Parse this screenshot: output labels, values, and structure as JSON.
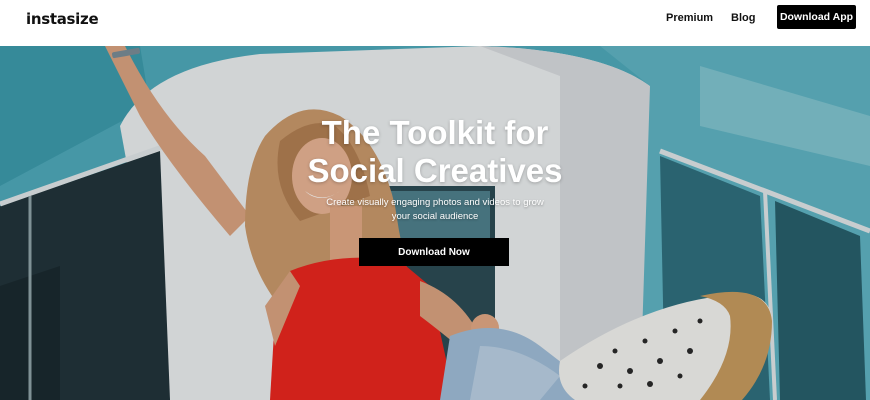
{
  "header": {
    "logo": "instasize",
    "nav": {
      "premium": "Premium",
      "blog": "Blog",
      "download_app": "Download App"
    }
  },
  "hero": {
    "title_line1": "The Toolkit for",
    "title_line2": "Social Creatives",
    "subtitle_line1": "Create visually engaging photos and videos to grow",
    "subtitle_line2": "your social audience",
    "cta_label": "Download Now"
  },
  "colors": {
    "header_bg": "#ffffff",
    "cta_bg": "#000000",
    "cta_text": "#ffffff",
    "wall_teal": "#4aa7b8",
    "top_red": "#e8261f"
  }
}
